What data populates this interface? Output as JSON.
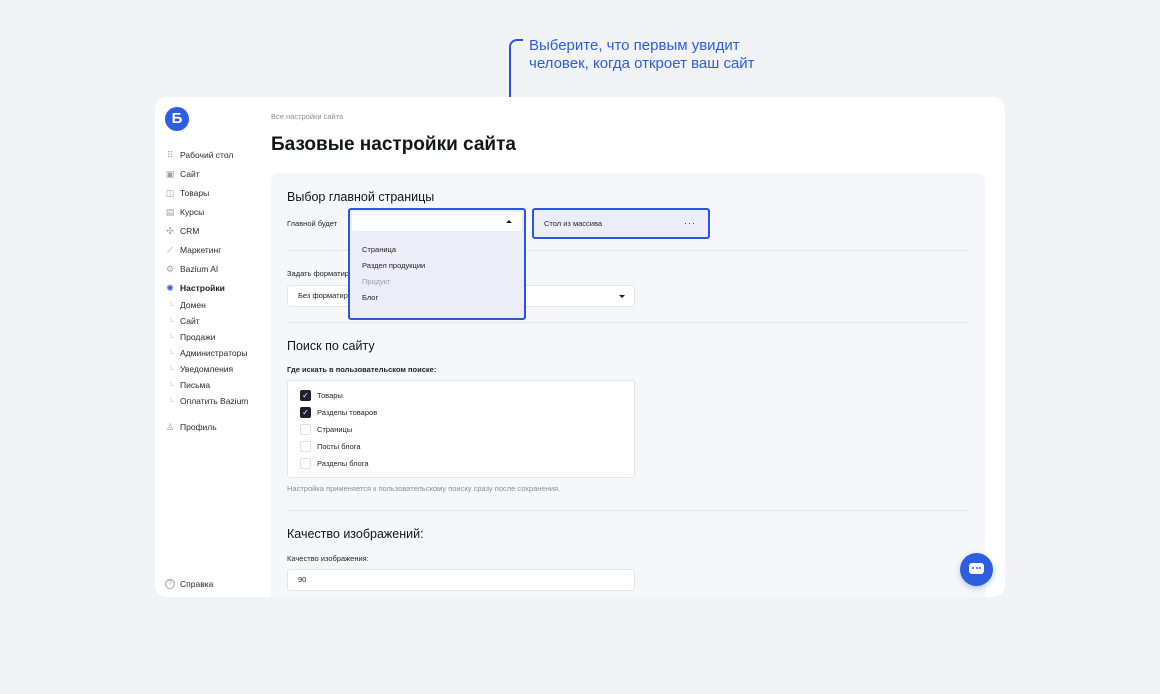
{
  "callout": {
    "line1": "Выберите, что первым увидит",
    "line2": "человек, когда откроет ваш сайт"
  },
  "sidebar": {
    "logo": "Б",
    "items": [
      {
        "label": "Рабочий стол",
        "icon": "dashboard-icon",
        "glyph": "⠿"
      },
      {
        "label": "Сайт",
        "icon": "layout-icon",
        "glyph": "▣"
      },
      {
        "label": "Товары",
        "icon": "bag-icon",
        "glyph": "◫"
      },
      {
        "label": "Курсы",
        "icon": "book-icon",
        "glyph": "▤"
      },
      {
        "label": "CRM",
        "icon": "crm-icon",
        "glyph": "✣"
      },
      {
        "label": "Маркетинг",
        "icon": "chart-icon",
        "glyph": "⟋"
      },
      {
        "label": "Bazium AI",
        "icon": "ai-icon",
        "glyph": "⚙"
      },
      {
        "label": "Настройки",
        "icon": "settings-icon",
        "glyph": "✺"
      }
    ],
    "sub_items": [
      "Домен",
      "Сайт",
      "Продажи",
      "Администраторы",
      "Уведомления",
      "Письма",
      "Оплатить Bazium"
    ],
    "profile": "Профиль",
    "help": "Справка"
  },
  "main": {
    "breadcrumb": "Все настройки сайта",
    "title": "Базовые настройки сайта"
  },
  "homepage": {
    "section_title": "Выбор главной страницы",
    "label": "Главной будет",
    "select_value": "",
    "options": [
      "Страница",
      "Раздел продукции",
      "Продукт",
      "Блог"
    ],
    "table_value": "Стол из массива",
    "more": "···"
  },
  "format": {
    "label": "Задать форматир",
    "value": "Без форматир"
  },
  "search": {
    "section_title": "Поиск по сайту",
    "label": "Где искать в пользовательском поиске:",
    "options": [
      {
        "label": "Товары",
        "checked": true
      },
      {
        "label": "Разделы товаров",
        "checked": true
      },
      {
        "label": "Страницы",
        "checked": false
      },
      {
        "label": "Посты блога",
        "checked": false
      },
      {
        "label": "Разделы блога",
        "checked": false
      }
    ],
    "note": "Настройка применяется к пользовательскому поиску сразу после сохранения."
  },
  "images": {
    "section_title": "Качество изображений:",
    "label": "Качество изображения:",
    "value": "90"
  },
  "colors": {
    "accent": "#2f5de0",
    "highlight_border": "#2b55dc",
    "checkbox_checked": "#1e2030"
  }
}
